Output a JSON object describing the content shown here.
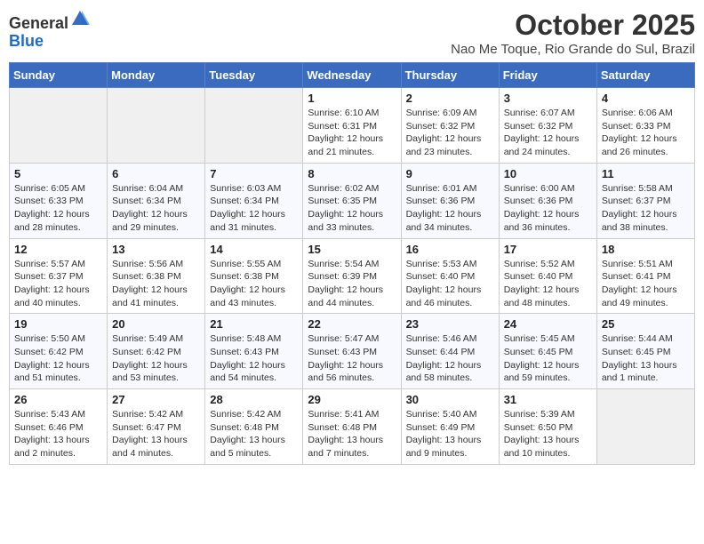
{
  "logo": {
    "general": "General",
    "blue": "Blue"
  },
  "header": {
    "month_year": "October 2025",
    "location": "Nao Me Toque, Rio Grande do Sul, Brazil"
  },
  "weekdays": [
    "Sunday",
    "Monday",
    "Tuesday",
    "Wednesday",
    "Thursday",
    "Friday",
    "Saturday"
  ],
  "weeks": [
    [
      {
        "day": "",
        "info": ""
      },
      {
        "day": "",
        "info": ""
      },
      {
        "day": "",
        "info": ""
      },
      {
        "day": "1",
        "info": "Sunrise: 6:10 AM\nSunset: 6:31 PM\nDaylight: 12 hours and 21 minutes."
      },
      {
        "day": "2",
        "info": "Sunrise: 6:09 AM\nSunset: 6:32 PM\nDaylight: 12 hours and 23 minutes."
      },
      {
        "day": "3",
        "info": "Sunrise: 6:07 AM\nSunset: 6:32 PM\nDaylight: 12 hours and 24 minutes."
      },
      {
        "day": "4",
        "info": "Sunrise: 6:06 AM\nSunset: 6:33 PM\nDaylight: 12 hours and 26 minutes."
      }
    ],
    [
      {
        "day": "5",
        "info": "Sunrise: 6:05 AM\nSunset: 6:33 PM\nDaylight: 12 hours and 28 minutes."
      },
      {
        "day": "6",
        "info": "Sunrise: 6:04 AM\nSunset: 6:34 PM\nDaylight: 12 hours and 29 minutes."
      },
      {
        "day": "7",
        "info": "Sunrise: 6:03 AM\nSunset: 6:34 PM\nDaylight: 12 hours and 31 minutes."
      },
      {
        "day": "8",
        "info": "Sunrise: 6:02 AM\nSunset: 6:35 PM\nDaylight: 12 hours and 33 minutes."
      },
      {
        "day": "9",
        "info": "Sunrise: 6:01 AM\nSunset: 6:36 PM\nDaylight: 12 hours and 34 minutes."
      },
      {
        "day": "10",
        "info": "Sunrise: 6:00 AM\nSunset: 6:36 PM\nDaylight: 12 hours and 36 minutes."
      },
      {
        "day": "11",
        "info": "Sunrise: 5:58 AM\nSunset: 6:37 PM\nDaylight: 12 hours and 38 minutes."
      }
    ],
    [
      {
        "day": "12",
        "info": "Sunrise: 5:57 AM\nSunset: 6:37 PM\nDaylight: 12 hours and 40 minutes."
      },
      {
        "day": "13",
        "info": "Sunrise: 5:56 AM\nSunset: 6:38 PM\nDaylight: 12 hours and 41 minutes."
      },
      {
        "day": "14",
        "info": "Sunrise: 5:55 AM\nSunset: 6:38 PM\nDaylight: 12 hours and 43 minutes."
      },
      {
        "day": "15",
        "info": "Sunrise: 5:54 AM\nSunset: 6:39 PM\nDaylight: 12 hours and 44 minutes."
      },
      {
        "day": "16",
        "info": "Sunrise: 5:53 AM\nSunset: 6:40 PM\nDaylight: 12 hours and 46 minutes."
      },
      {
        "day": "17",
        "info": "Sunrise: 5:52 AM\nSunset: 6:40 PM\nDaylight: 12 hours and 48 minutes."
      },
      {
        "day": "18",
        "info": "Sunrise: 5:51 AM\nSunset: 6:41 PM\nDaylight: 12 hours and 49 minutes."
      }
    ],
    [
      {
        "day": "19",
        "info": "Sunrise: 5:50 AM\nSunset: 6:42 PM\nDaylight: 12 hours and 51 minutes."
      },
      {
        "day": "20",
        "info": "Sunrise: 5:49 AM\nSunset: 6:42 PM\nDaylight: 12 hours and 53 minutes."
      },
      {
        "day": "21",
        "info": "Sunrise: 5:48 AM\nSunset: 6:43 PM\nDaylight: 12 hours and 54 minutes."
      },
      {
        "day": "22",
        "info": "Sunrise: 5:47 AM\nSunset: 6:43 PM\nDaylight: 12 hours and 56 minutes."
      },
      {
        "day": "23",
        "info": "Sunrise: 5:46 AM\nSunset: 6:44 PM\nDaylight: 12 hours and 58 minutes."
      },
      {
        "day": "24",
        "info": "Sunrise: 5:45 AM\nSunset: 6:45 PM\nDaylight: 12 hours and 59 minutes."
      },
      {
        "day": "25",
        "info": "Sunrise: 5:44 AM\nSunset: 6:45 PM\nDaylight: 13 hours and 1 minute."
      }
    ],
    [
      {
        "day": "26",
        "info": "Sunrise: 5:43 AM\nSunset: 6:46 PM\nDaylight: 13 hours and 2 minutes."
      },
      {
        "day": "27",
        "info": "Sunrise: 5:42 AM\nSunset: 6:47 PM\nDaylight: 13 hours and 4 minutes."
      },
      {
        "day": "28",
        "info": "Sunrise: 5:42 AM\nSunset: 6:48 PM\nDaylight: 13 hours and 5 minutes."
      },
      {
        "day": "29",
        "info": "Sunrise: 5:41 AM\nSunset: 6:48 PM\nDaylight: 13 hours and 7 minutes."
      },
      {
        "day": "30",
        "info": "Sunrise: 5:40 AM\nSunset: 6:49 PM\nDaylight: 13 hours and 9 minutes."
      },
      {
        "day": "31",
        "info": "Sunrise: 5:39 AM\nSunset: 6:50 PM\nDaylight: 13 hours and 10 minutes."
      },
      {
        "day": "",
        "info": ""
      }
    ]
  ]
}
